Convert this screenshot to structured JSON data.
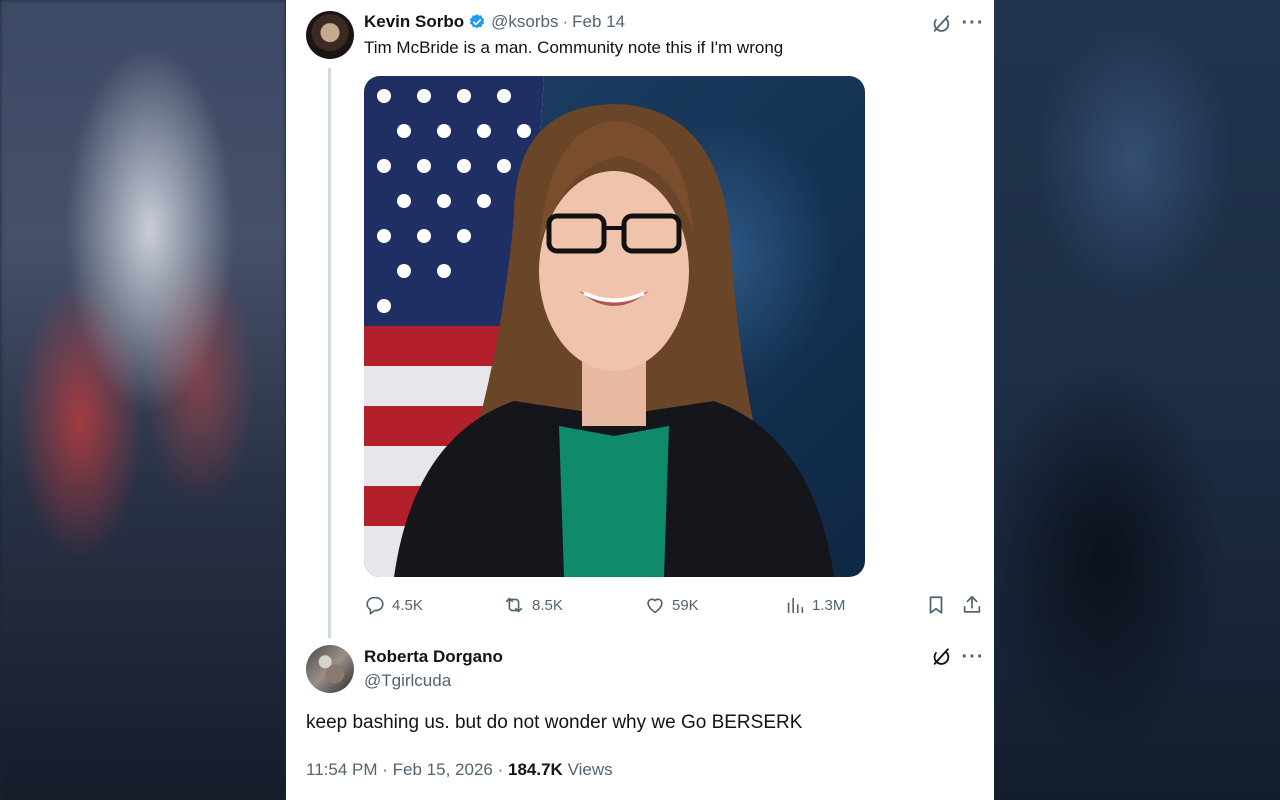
{
  "tweet": {
    "author_name": "Kevin Sorbo",
    "author_handle": "@ksorbs",
    "separator": "·",
    "date": "Feb 14",
    "text": "Tim McBride is a man. Community note this if I'm wrong",
    "stats": {
      "replies": "4.5K",
      "retweets": "8.5K",
      "likes": "59K",
      "views": "1.3M"
    }
  },
  "reply": {
    "author_name": "Roberta Dorgano",
    "author_handle": "@Tgirlcuda",
    "text": "keep bashing us. but do not wonder why we Go BERSERK",
    "time": "11:54 PM",
    "date": "Feb 15, 2026",
    "separator": "·",
    "views_count": "184.7K",
    "views_label": "Views"
  },
  "icons": {
    "verified": "verified-badge-icon",
    "grok": "grok-icon",
    "more": "more-icon",
    "reply": "reply-icon",
    "retweet": "retweet-icon",
    "like": "like-icon",
    "views": "views-icon",
    "bookmark": "bookmark-icon",
    "share": "share-icon"
  },
  "colors": {
    "verified": "#1d9bf0",
    "text_primary": "#0f1419",
    "text_secondary": "#536471",
    "thread_line": "#cfd9de"
  }
}
